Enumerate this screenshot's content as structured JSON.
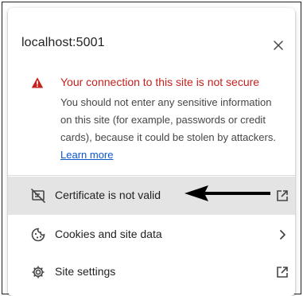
{
  "popup": {
    "title": "localhost:5001",
    "close_icon": "close-icon"
  },
  "warning": {
    "icon": "warning-triangle-icon",
    "heading": "Your connection to this site is not secure",
    "body_lines": [
      "You should not enter any sensitive information",
      "on this site (for example, passwords or credit",
      "cards), because it could be stolen by attackers."
    ],
    "learn_more": "Learn more",
    "color": "#c5221f"
  },
  "menu": {
    "certificate": {
      "icon": "certificate-icon",
      "label": "Certificate is not valid",
      "trailing_icon": "external-link-icon"
    },
    "cookies": {
      "icon": "cookie-icon",
      "label": "Cookies and site data",
      "trailing_icon": "chevron-right-icon"
    },
    "site_settings": {
      "icon": "settings-gear-icon",
      "label": "Site settings",
      "trailing_icon": "external-link-icon"
    }
  },
  "annotation": {
    "icon": "arrow-left-icon"
  },
  "colors": {
    "link": "#0b57d0",
    "hover_row": "#e4e4e4",
    "text": "#1f1f1f"
  }
}
